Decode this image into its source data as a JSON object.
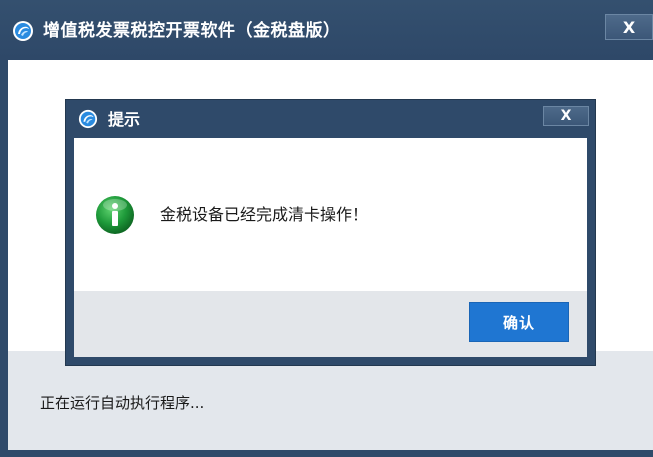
{
  "main_window": {
    "title": "增值税发票税控开票软件（金税盘版）",
    "close_glyph": "X",
    "status_text": "正在运行自动执行程序..."
  },
  "dialog": {
    "title": "提示",
    "close_glyph": "X",
    "message": "金税设备已经完成清卡操作！",
    "ok_label": "确认"
  },
  "icons": {
    "app_logo": "app-logo-icon",
    "info": "info-icon",
    "close": "close-icon"
  },
  "colors": {
    "titlebar": "#2f4a6a",
    "primary_button": "#1f76d2",
    "info_icon": "#1e9a3a",
    "footer": "#e3e6ea"
  }
}
